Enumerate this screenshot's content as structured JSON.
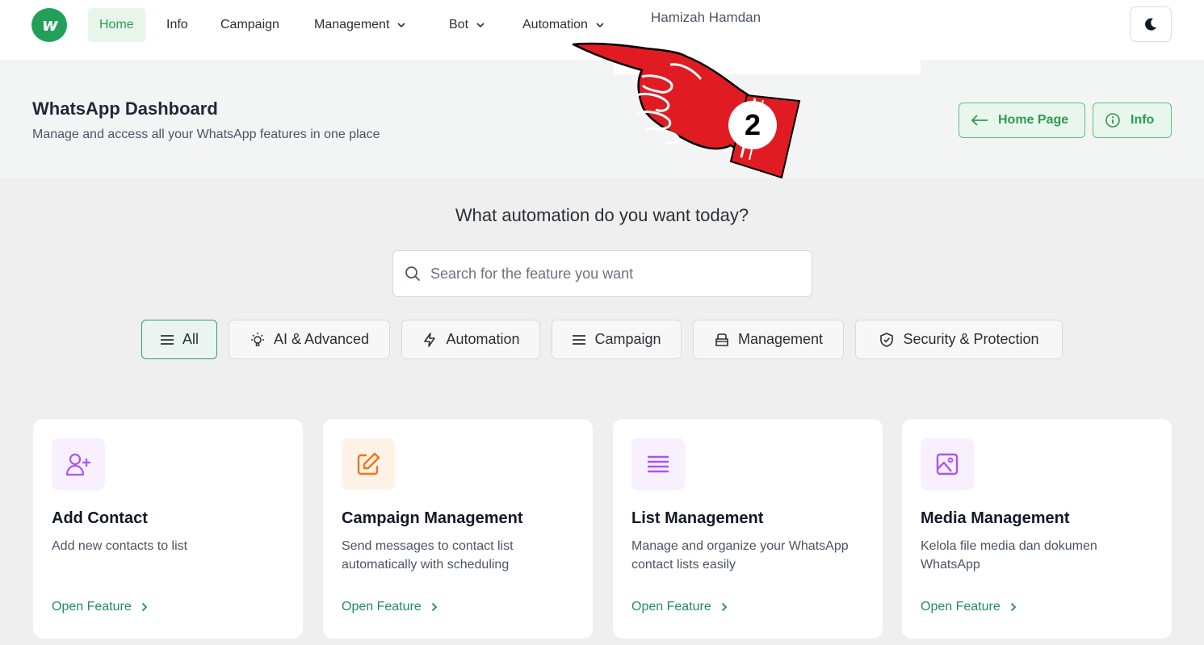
{
  "nav": {
    "logo_letter": "w",
    "items": [
      {
        "label": "Home",
        "active": true
      },
      {
        "label": "Info"
      },
      {
        "label": "Campaign"
      },
      {
        "label": "Management",
        "dropdown": true
      },
      {
        "label": "Bot",
        "dropdown": true
      },
      {
        "label": "Automation",
        "dropdown": true
      }
    ],
    "user_name": "Hamizah Hamdan",
    "theme_icon": "moon-icon"
  },
  "header": {
    "title": "WhatsApp Dashboard",
    "subtitle": "Manage and access all your WhatsApp features in one place",
    "home_button": "Home Page",
    "info_button": "Info"
  },
  "main": {
    "question": "What automation do you want today?",
    "search_placeholder": "Search for the feature you want",
    "filters": [
      {
        "label": "All",
        "icon": "menu-icon",
        "active": true
      },
      {
        "label": "AI & Advanced",
        "icon": "lightbulb-icon"
      },
      {
        "label": "Automation",
        "icon": "lightning-icon"
      },
      {
        "label": "Campaign",
        "icon": "menu-icon"
      },
      {
        "label": "Management",
        "icon": "archive-icon"
      },
      {
        "label": "Security & Protection",
        "icon": "shield-icon"
      }
    ],
    "cards": [
      {
        "title": "Add Contact",
        "desc": "Add new contacts to list",
        "link": "Open Feature",
        "icon": "user-plus-icon"
      },
      {
        "title": "Campaign Management",
        "desc": "Send messages to contact list automatically with scheduling",
        "link": "Open Feature",
        "icon": "edit-icon"
      },
      {
        "title": "List Management",
        "desc": "Manage and organize your WhatsApp contact lists easily",
        "link": "Open Feature",
        "icon": "list-icon"
      },
      {
        "title": "Media Management",
        "desc": "Kelola file media dan dokumen WhatsApp",
        "link": "Open Feature",
        "icon": "image-icon"
      }
    ]
  },
  "annotation": {
    "step_number": "2",
    "colors": {
      "hand": "#e01b22",
      "outline": "#000000"
    }
  },
  "colors": {
    "brand_green": "#22a05a",
    "accent_teal": "#1f8a6e",
    "purple": "#a855f7",
    "orange": "#f97316"
  }
}
